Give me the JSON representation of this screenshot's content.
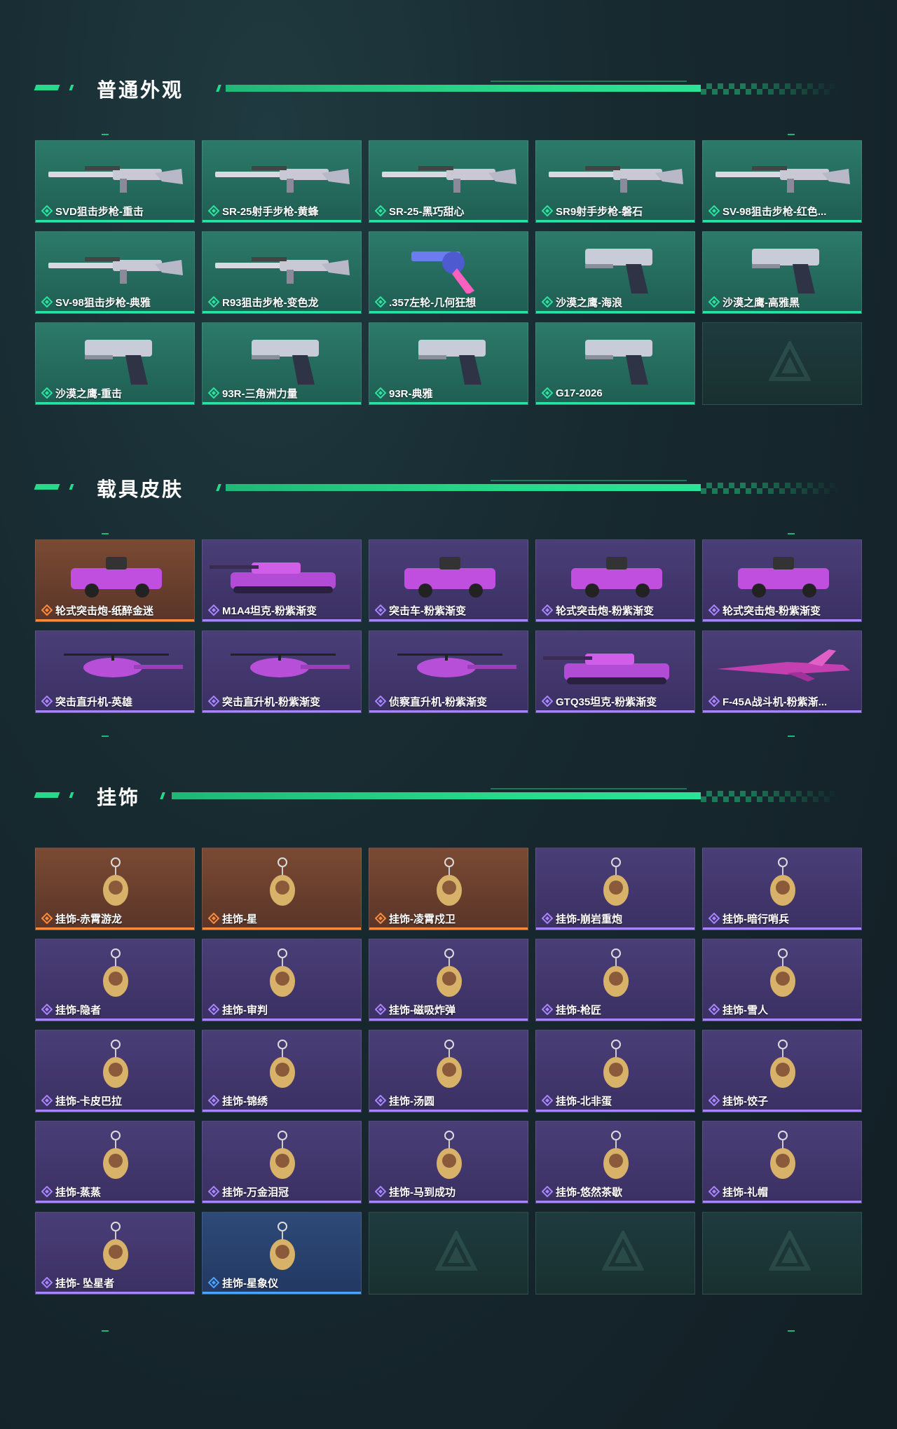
{
  "colors": {
    "accent": "#27d98a",
    "rarity_green": "#2be3a0",
    "rarity_purple": "#a884ff",
    "rarity_orange": "#ff8a3d",
    "rarity_blue": "#4aa3ff"
  },
  "sections": [
    {
      "title": "普通外观",
      "items": [
        {
          "label": "SVD狙击步枪-重击",
          "rarity": "green",
          "icon": "rifle-icon"
        },
        {
          "label": "SR-25射手步枪-黄蜂",
          "rarity": "green",
          "icon": "rifle-icon"
        },
        {
          "label": "SR-25-黑巧甜心",
          "rarity": "green",
          "icon": "rifle-icon"
        },
        {
          "label": "SR9射手步枪-磐石",
          "rarity": "green",
          "icon": "rifle-icon"
        },
        {
          "label": "SV-98狙击步枪-红色...",
          "rarity": "green",
          "icon": "rifle-icon"
        },
        {
          "label": "SV-98狙击步枪-典雅",
          "rarity": "green",
          "icon": "rifle-icon"
        },
        {
          "label": "R93狙击步枪-变色龙",
          "rarity": "green",
          "icon": "rifle-icon"
        },
        {
          "label": ".357左轮-几何狂想",
          "rarity": "green",
          "icon": "revolver-icon"
        },
        {
          "label": "沙漠之鹰-海浪",
          "rarity": "green",
          "icon": "pistol-icon"
        },
        {
          "label": "沙漠之鹰-高雅黑",
          "rarity": "green",
          "icon": "pistol-icon"
        },
        {
          "label": "沙漠之鹰-重击",
          "rarity": "green",
          "icon": "pistol-icon"
        },
        {
          "label": "93R-三角洲力量",
          "rarity": "green",
          "icon": "pistol-icon"
        },
        {
          "label": "93R-典雅",
          "rarity": "green",
          "icon": "pistol-icon"
        },
        {
          "label": "G17-2026",
          "rarity": "green",
          "icon": "pistol-icon"
        },
        {
          "label": "",
          "rarity": "empty",
          "icon": "empty-slot-icon"
        }
      ]
    },
    {
      "title": "载具皮肤",
      "items": [
        {
          "label": "轮式突击炮-纸醉金迷",
          "rarity": "orange",
          "icon": "armored-car-icon"
        },
        {
          "label": "M1A4坦克-粉紫渐变",
          "rarity": "purple",
          "icon": "tank-icon"
        },
        {
          "label": "突击车-粉紫渐变",
          "rarity": "purple",
          "icon": "armored-car-icon"
        },
        {
          "label": "轮式突击炮-粉紫渐变",
          "rarity": "purple",
          "icon": "armored-car-icon"
        },
        {
          "label": "轮式突击炮-粉紫渐变",
          "rarity": "purple",
          "icon": "armored-car-icon"
        },
        {
          "label": "突击直升机-英雄",
          "rarity": "purple",
          "icon": "helicopter-icon"
        },
        {
          "label": "突击直升机-粉紫渐变",
          "rarity": "purple",
          "icon": "helicopter-icon"
        },
        {
          "label": "侦察直升机-粉紫渐变",
          "rarity": "purple",
          "icon": "helicopter-icon"
        },
        {
          "label": "GTQ35坦克-粉紫渐变",
          "rarity": "purple",
          "icon": "tank-icon"
        },
        {
          "label": "F-45A战斗机-粉紫渐...",
          "rarity": "purple",
          "icon": "jet-icon"
        }
      ]
    },
    {
      "title": "挂饰",
      "items": [
        {
          "label": "挂饰-赤霄游龙",
          "rarity": "orange",
          "icon": "charm-icon"
        },
        {
          "label": "挂饰-星",
          "rarity": "orange",
          "icon": "charm-icon"
        },
        {
          "label": "挂饰-凌霄戍卫",
          "rarity": "orange",
          "icon": "charm-icon"
        },
        {
          "label": "挂饰-崩岩重炮",
          "rarity": "purple",
          "icon": "charm-icon"
        },
        {
          "label": "挂饰-暗行哨兵",
          "rarity": "purple",
          "icon": "charm-icon"
        },
        {
          "label": "挂饰-隐者",
          "rarity": "purple",
          "icon": "charm-icon"
        },
        {
          "label": "挂饰-审判",
          "rarity": "purple",
          "icon": "charm-icon"
        },
        {
          "label": "挂饰-磁吸炸弹",
          "rarity": "purple",
          "icon": "charm-icon"
        },
        {
          "label": "挂饰-枪匠",
          "rarity": "purple",
          "icon": "charm-icon"
        },
        {
          "label": "挂饰-雪人",
          "rarity": "purple",
          "icon": "charm-icon"
        },
        {
          "label": "挂饰-卡皮巴拉",
          "rarity": "purple",
          "icon": "charm-icon"
        },
        {
          "label": "挂饰-锦绣",
          "rarity": "purple",
          "icon": "charm-icon"
        },
        {
          "label": "挂饰-汤圆",
          "rarity": "purple",
          "icon": "charm-icon"
        },
        {
          "label": "挂饰-北非蛋",
          "rarity": "purple",
          "icon": "charm-icon"
        },
        {
          "label": "挂饰-饺子",
          "rarity": "purple",
          "icon": "charm-icon"
        },
        {
          "label": "挂饰-蒸蒸",
          "rarity": "purple",
          "icon": "charm-icon"
        },
        {
          "label": "挂饰-万金泪冠",
          "rarity": "purple",
          "icon": "charm-icon"
        },
        {
          "label": "挂饰-马到成功",
          "rarity": "purple",
          "icon": "charm-icon"
        },
        {
          "label": "挂饰-悠然茶歇",
          "rarity": "purple",
          "icon": "charm-icon"
        },
        {
          "label": "挂饰-礼帽",
          "rarity": "purple",
          "icon": "charm-icon"
        },
        {
          "label": "挂饰- 坠星者",
          "rarity": "purple",
          "icon": "charm-icon"
        },
        {
          "label": "挂饰-星象仪",
          "rarity": "blue",
          "icon": "charm-icon"
        },
        {
          "label": "",
          "rarity": "empty",
          "icon": "empty-slot-icon"
        },
        {
          "label": "",
          "rarity": "empty",
          "icon": "empty-slot-icon"
        },
        {
          "label": "",
          "rarity": "empty",
          "icon": "empty-slot-icon"
        }
      ]
    }
  ]
}
